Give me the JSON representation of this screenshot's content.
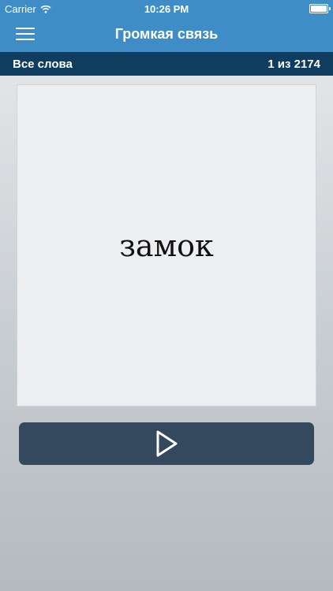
{
  "status_bar": {
    "carrier": "Carrier",
    "time": "10:26 PM"
  },
  "nav": {
    "title": "Громкая связь",
    "menu_icon": "hamburger-icon"
  },
  "subheader": {
    "category": "Все слова",
    "counter": "1 из 2174"
  },
  "card": {
    "word": "замок"
  },
  "player": {
    "icon": "play-icon"
  },
  "colors": {
    "nav": "#3f8dc6",
    "subheader": "#0e3d60",
    "card": "#eceeef",
    "button": "#34495e"
  }
}
